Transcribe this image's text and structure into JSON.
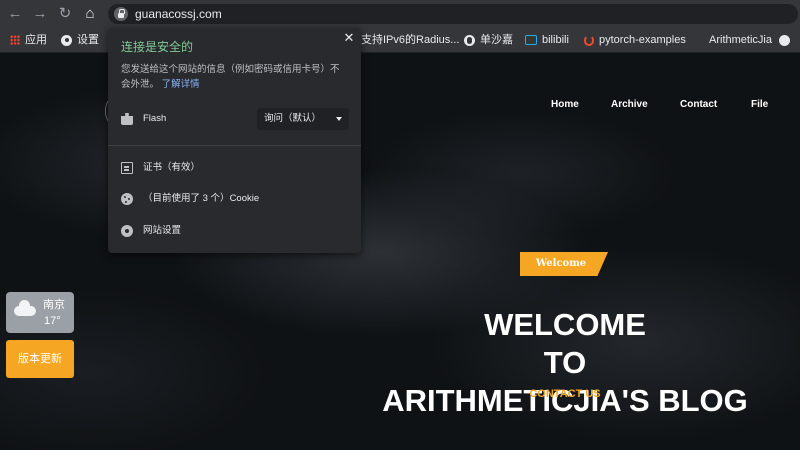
{
  "browser": {
    "url": "guanacossj.com",
    "bookmarks": [
      {
        "label": "应用",
        "icon": "apps-grid-icon"
      },
      {
        "label": "设置",
        "icon": "gear-icon"
      },
      {
        "label": "支持IPv6的Radius...",
        "icon": ""
      },
      {
        "label": "单沙嘉",
        "icon": "globe-icon"
      },
      {
        "label": "bilibili",
        "icon": "bilibili-icon"
      },
      {
        "label": "pytorch-examples",
        "icon": "pytorch-icon"
      },
      {
        "label": "ArithmeticJia",
        "icon": ""
      },
      {
        "label": "",
        "icon": "github-icon"
      }
    ]
  },
  "popup": {
    "title": "连接是安全的",
    "description": "您发送给这个网站的信息（例如密码或信用卡号）不会外泄。",
    "learn_more": "了解详情",
    "flash_label": "Flash",
    "flash_value": "询问（默认）",
    "cert_label": "证书（有效）",
    "cookie_label": "（目前使用了 3 个）Cookie",
    "site_settings_label": "网站设置"
  },
  "site": {
    "nav": [
      "Home",
      "Archive",
      "Contact",
      "File"
    ],
    "badge": "Welcome",
    "hero": [
      "WELCOME",
      "TO",
      "ARITHMETICJIA'S BLOG"
    ],
    "contact": "CONTACT US",
    "weather_city": "南京",
    "weather_temp": "17°",
    "update_button": "版本更新"
  },
  "colors": {
    "accent": "#f5a623",
    "secure_green": "#81c995",
    "link_blue": "#8ab4f8"
  }
}
